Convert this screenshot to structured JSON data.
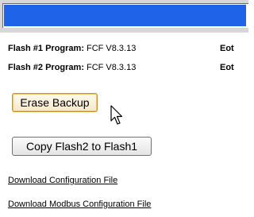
{
  "progress": {
    "fill_fraction": 0.99,
    "color": "#1f63e8"
  },
  "flash_info": [
    {
      "label": "Flash #1 Program:",
      "value": "FCF V8.3.13",
      "extra": "Eot"
    },
    {
      "label": "Flash #2 Program:",
      "value": "FCF V8.3.13",
      "extra": "Eot"
    }
  ],
  "buttons": {
    "erase_backup": "Erase Backup",
    "copy_flash": "Copy Flash2 to Flash1"
  },
  "links": {
    "download_config": "Download Configuration File",
    "download_modbus_config": "Download Modbus Configuration File"
  },
  "icons": {
    "cursor": "mouse-pointer-icon"
  }
}
